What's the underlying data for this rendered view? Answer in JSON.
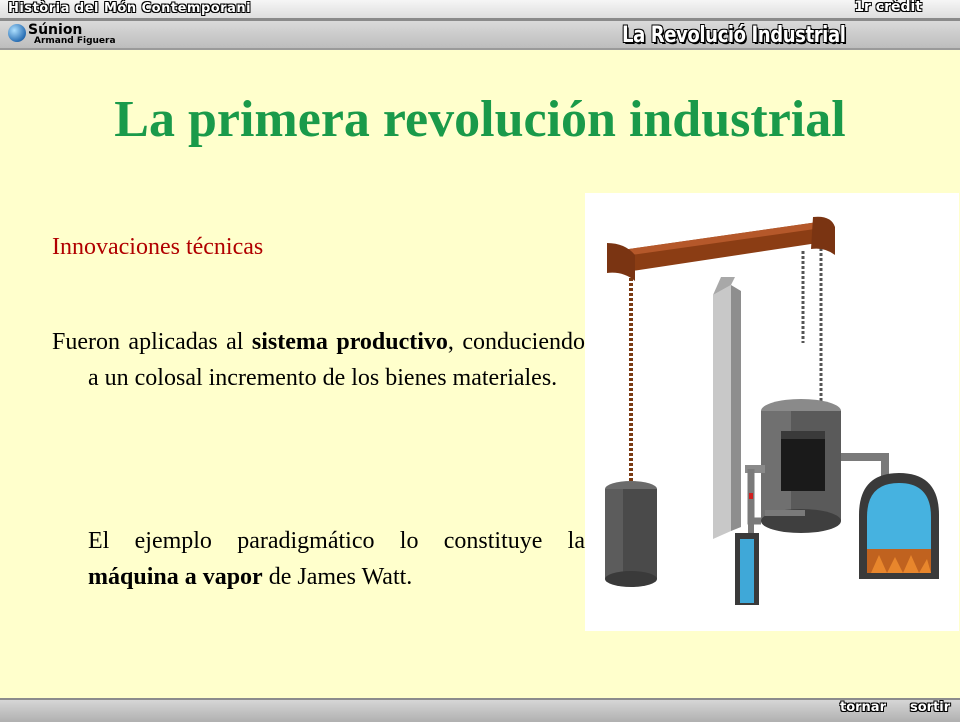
{
  "header": {
    "course_title": "Història del Món Contemporani",
    "credit": "1r crèdit",
    "brand": "Súnion",
    "author": "Armand Figuera",
    "unit_title": "La Revolució Industrial"
  },
  "slide": {
    "title": "La primera revolución industrial",
    "subtitle": "Innovaciones técnicas",
    "paragraph1": {
      "t1": "Fueron aplicadas al ",
      "b1": "sistema productivo",
      "t2": ", conduciendo a un colosal incremento de los bienes materiales."
    },
    "paragraph2": {
      "t1": "El ejemplo paradigmático lo constituye la ",
      "b1": "máquina a vapor",
      "t2": " de James Watt."
    }
  },
  "footer": {
    "back_label": "tornar",
    "exit_label": "sortir"
  },
  "colors": {
    "background": "#ffffcc",
    "title": "#1a9a4a",
    "subtitle": "#b00000"
  }
}
